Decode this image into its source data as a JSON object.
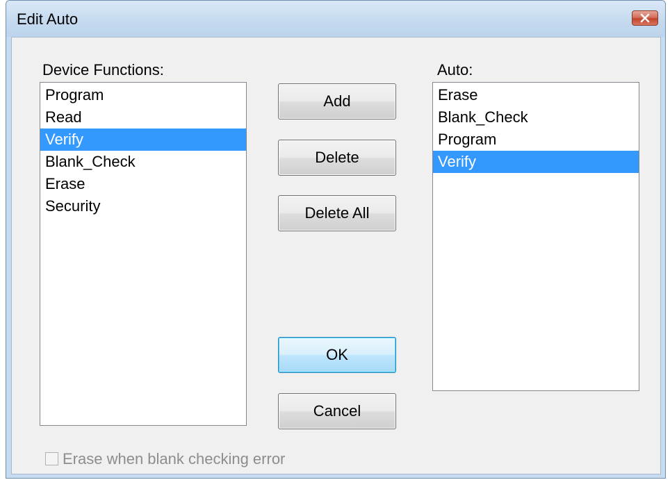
{
  "window": {
    "title": "Edit Auto",
    "close_icon": "close-x-icon"
  },
  "device_functions": {
    "label": "Device Functions:",
    "items": [
      {
        "text": "Program",
        "selected": false
      },
      {
        "text": "Read",
        "selected": false
      },
      {
        "text": "Verify",
        "selected": true
      },
      {
        "text": "Blank_Check",
        "selected": false
      },
      {
        "text": "Erase",
        "selected": false
      },
      {
        "text": "Security",
        "selected": false
      }
    ]
  },
  "auto": {
    "label": "Auto:",
    "items": [
      {
        "text": "Erase",
        "selected": false
      },
      {
        "text": "Blank_Check",
        "selected": false
      },
      {
        "text": "Program",
        "selected": false
      },
      {
        "text": "Verify",
        "selected": true
      }
    ]
  },
  "buttons": {
    "add": "Add",
    "delete": "Delete",
    "delete_all": "Delete All",
    "ok": "OK",
    "cancel": "Cancel"
  },
  "erase_option": {
    "label": "Erase when blank checking error",
    "checked": false,
    "enabled": false
  },
  "colors": {
    "selection": "#3399ff",
    "selection_text": "#ffffff",
    "disabled_text": "#8d8d8d"
  }
}
